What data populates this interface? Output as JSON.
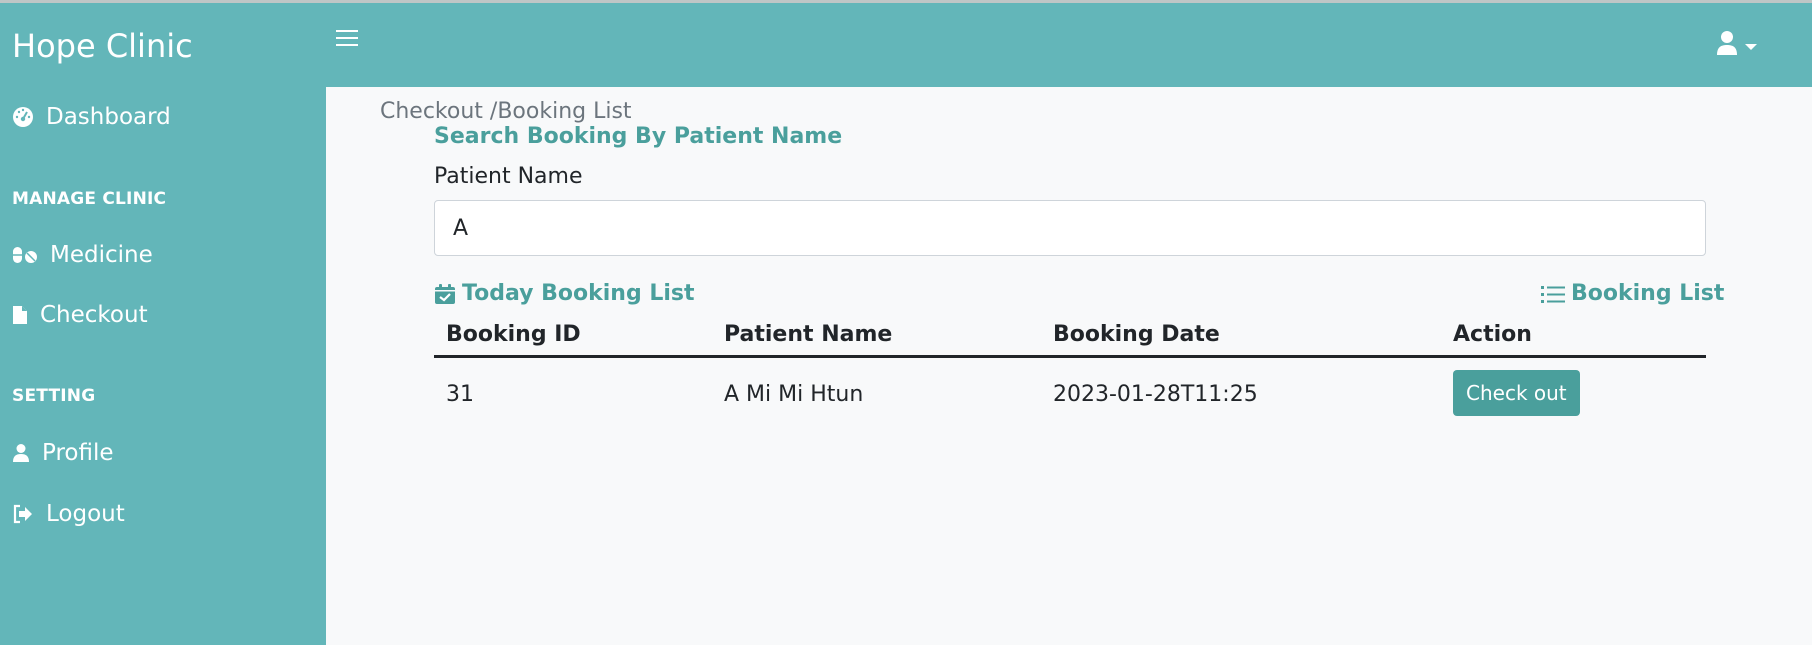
{
  "app": {
    "brand": "Hope Clinic"
  },
  "sidebar": {
    "items": [
      {
        "label": "Dashboard",
        "icon": "gauge-icon"
      },
      {
        "heading": "MANAGE CLINIC"
      },
      {
        "label": "Medicine",
        "icon": "pills-icon"
      },
      {
        "label": "Checkout",
        "icon": "file-icon"
      },
      {
        "heading": "SETTING"
      },
      {
        "label": "Profile",
        "icon": "user-icon"
      },
      {
        "label": "Logout",
        "icon": "logout-icon"
      }
    ]
  },
  "topbar": {
    "menu_icon": "hamburger-icon",
    "user_icon": "user-icon"
  },
  "main": {
    "breadcrumb": "Checkout /Booking List",
    "search_title": "Search Booking By Patient Name",
    "patient_name_label": "Patient Name",
    "patient_name_value": "A",
    "today_list_title": "Today Booking List",
    "booking_list_link": "Booking List",
    "table": {
      "headers": [
        "Booking ID",
        "Patient Name",
        "Booking Date",
        "Action"
      ],
      "rows": [
        {
          "id": "31",
          "patient": "A Mi Mi Htun",
          "date": "2023-01-28T11:25",
          "action": "Check out"
        }
      ]
    }
  },
  "colors": {
    "primary": "#63b6b9",
    "accent": "#4a9f9c",
    "background": "#f8f9fa"
  }
}
